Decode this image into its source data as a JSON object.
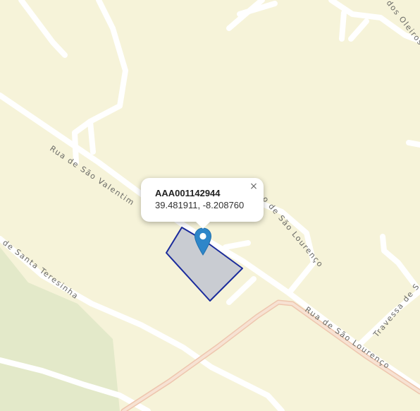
{
  "map": {
    "streets": [
      "Rua de São Valentim",
      "o de São Lourenço",
      "de Santa Teresinha",
      "Rua de São Lourenço",
      "Travessa de S",
      "dos Oleiros"
    ],
    "parcel": {
      "fill": "#c9ccd2",
      "stroke": "#1a2b9c"
    },
    "marker": {
      "icon": "map-pin-icon",
      "color": "#2e86c9"
    },
    "popup": {
      "title": "AAA001142944",
      "coords": "39.481911, -8.208760",
      "close_label": "×"
    },
    "colors": {
      "background": "#f6f3d9",
      "road": "#ffffff",
      "main_road": "#f4d9c6",
      "park": "#e3e9c9"
    }
  }
}
